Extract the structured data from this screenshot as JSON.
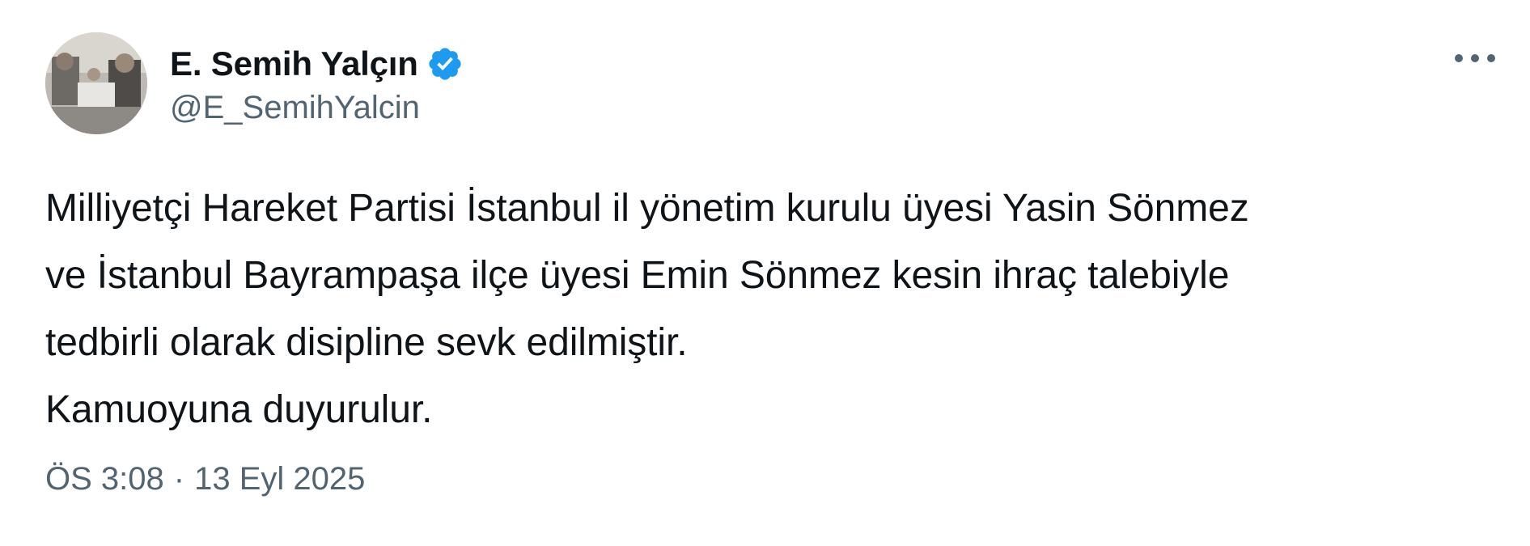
{
  "author": {
    "display_name": "E. Semih Yalçın",
    "handle": "@E_SemihYalcin",
    "verified": true,
    "avatar": "profile-photo"
  },
  "tweet": {
    "lines": [
      "Milliyetçi Hareket Partisi İstanbul il yönetim kurulu üyesi Yasin Sönmez",
      "ve İstanbul Bayrampaşa ilçe üyesi Emin Sönmez kesin ihraç talebiyle",
      "tedbirli olarak disipline sevk edilmiştir.",
      "Kamuoyuna duyurulur."
    ],
    "time": "ÖS 3:08",
    "separator": "·",
    "date": "13 Eyl 2025"
  },
  "icons": {
    "verified": "verified-badge-icon",
    "more": "more-horizontal-icon"
  },
  "colors": {
    "verified_blue": "#1d9bf0",
    "text_primary": "#0f1419",
    "text_secondary": "#536471",
    "background": "#ffffff"
  }
}
